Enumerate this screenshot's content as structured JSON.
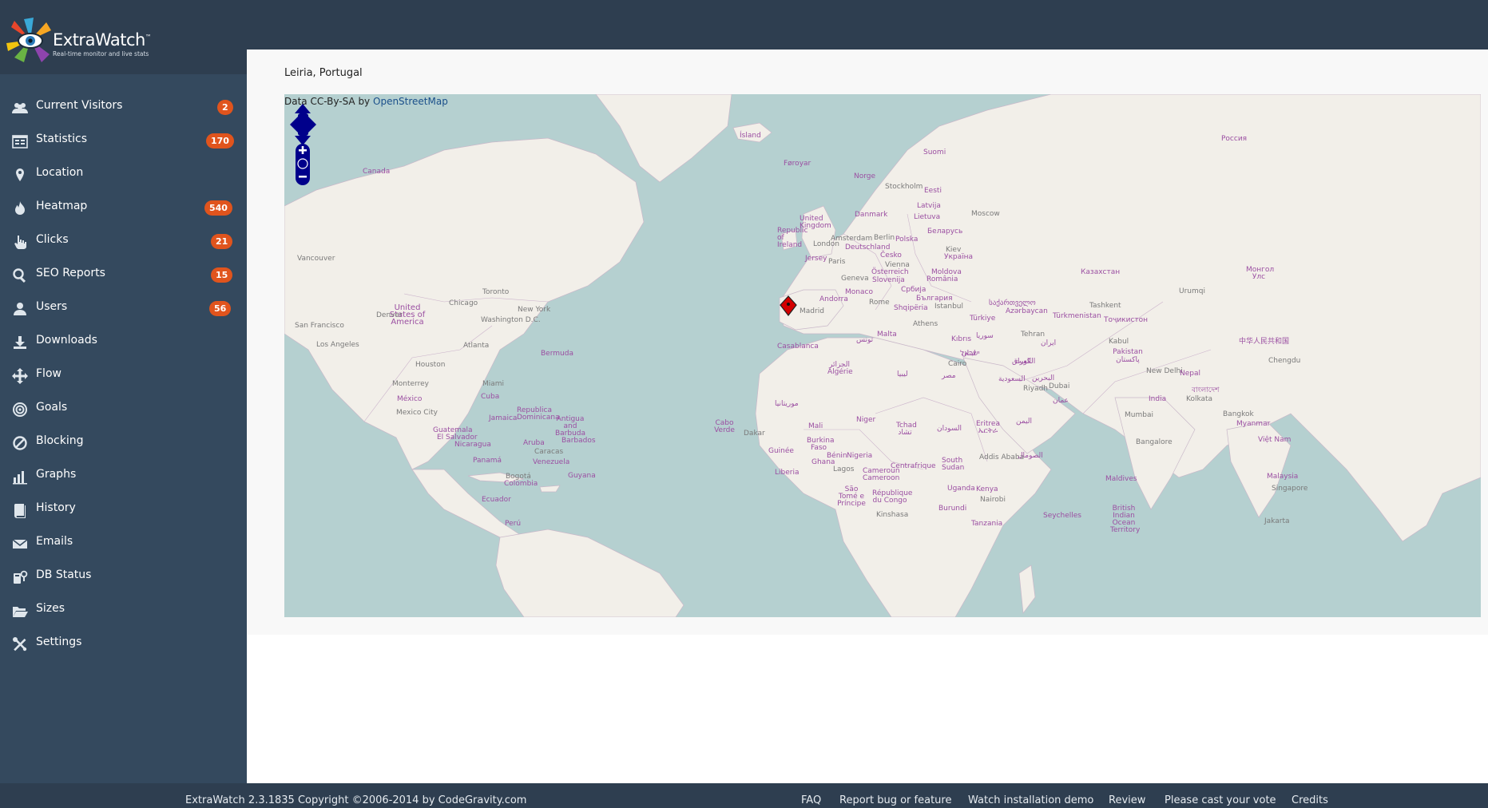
{
  "brand": {
    "name": "ExtraWatch",
    "tm": "™",
    "tagline": "Real-time monitor and live stats"
  },
  "sidebar": {
    "items": [
      {
        "label": "Current Visitors",
        "icon": "users-icon",
        "badge": "2"
      },
      {
        "label": "Statistics",
        "icon": "statistics-icon",
        "badge": "170"
      },
      {
        "label": "Location",
        "icon": "map-pin-icon",
        "badge": null
      },
      {
        "label": "Heatmap",
        "icon": "fire-icon",
        "badge": "540"
      },
      {
        "label": "Clicks",
        "icon": "pointer-hand-icon",
        "badge": "21"
      },
      {
        "label": "SEO Reports",
        "icon": "search-icon",
        "badge": "15"
      },
      {
        "label": "Users",
        "icon": "user-icon",
        "badge": "56"
      },
      {
        "label": "Downloads",
        "icon": "download-icon",
        "badge": null
      },
      {
        "label": "Flow",
        "icon": "flow-arrows-icon",
        "badge": null
      },
      {
        "label": "Goals",
        "icon": "target-icon",
        "badge": null
      },
      {
        "label": "Blocking",
        "icon": "block-icon",
        "badge": null
      },
      {
        "label": "Graphs",
        "icon": "bar-chart-icon",
        "badge": null
      },
      {
        "label": "History",
        "icon": "book-icon",
        "badge": null
      },
      {
        "label": "Emails",
        "icon": "envelope-icon",
        "badge": null
      },
      {
        "label": "DB Status",
        "icon": "database-icon",
        "badge": null
      },
      {
        "label": "Sizes",
        "icon": "folder-open-icon",
        "badge": null
      },
      {
        "label": "Settings",
        "icon": "wrench-icon",
        "badge": null
      }
    ]
  },
  "main": {
    "location": "Leiria, Portugal",
    "map": {
      "attribution_prefix": "Data CC-By-SA by",
      "attribution_link": "OpenStreetMap",
      "marker_location": "Leiria, Portugal",
      "marker_color": "#d40000",
      "water_color": "#b5d0d0",
      "land_color": "#f2efe9",
      "labels": {
        "island": "Ísland",
        "faroyar": "Føroyar",
        "canada": "Canada",
        "suomi": "Suomi",
        "norge": "Norge",
        "rossiya": "Россия",
        "eesti": "Eesti",
        "stockholm": "Stockholm",
        "latvija": "Latvija",
        "lietuva": "Lietuva",
        "danmark": "Danmark",
        "uk": "United Kingdom",
        "ireland": "Republic of Ireland",
        "moscow": "Moscow",
        "belarus": "Беларусь",
        "berlin": "Berlin",
        "amsterdam": "Amsterdam",
        "london": "London",
        "deutschland": "Deutschland",
        "polska": "Polska",
        "kiev": "Kiev",
        "ukraina": "Україна",
        "jersey": "Jersey",
        "paris": "Paris",
        "cesko": "Česko",
        "vienna": "Vienna",
        "geneva": "Geneva",
        "osterreich": "Österreich",
        "slovenija": "Slovenija",
        "moldova": "Moldova",
        "romania": "România",
        "kazakhstan": "Казахстан",
        "mongolia": "Монгол Улс",
        "vancouver": "Vancouver",
        "toronto": "Toronto",
        "chicago": "Chicago",
        "new_york": "New York",
        "washington": "Washington D.C.",
        "usa": "United States of America",
        "denver": "Denver",
        "san_francisco": "San Francisco",
        "los_angeles": "Los Angeles",
        "atlanta": "Atlanta",
        "houston": "Houston",
        "bermuda": "Bermuda",
        "monaco": "Monaco",
        "andorra": "Andorra",
        "madrid": "Madrid",
        "rome": "Rome",
        "srbija": "Србија",
        "bulgaria": "България",
        "shqiperia": "Shqipëria",
        "istanbul": "Istanbul",
        "turkiye": "Türkiye",
        "athens": "Athens",
        "georgia": "საქართველო",
        "azerbaycan": "Azərbaycan",
        "turkmenistan": "Türkmenistan",
        "tajikistan": "Тоҷикистон",
        "tashkent": "Tashkent",
        "urumqi": "Urumqi",
        "china": "中华人民共和国",
        "malta": "Malta",
        "casablanca": "Casablanca",
        "tunisia": "تونس",
        "kibris": "Kıbrıs",
        "syria": "سوريا",
        "lebanon": "لبنان",
        "iraq": "العراق",
        "tehran": "Tehran",
        "iran": "ایران",
        "kabul": "Kabul",
        "pakistan": "Pakistan پاکستان",
        "chengdu": "Chengdu",
        "new_delhi": "New Delhi",
        "nepal": "Nepal",
        "mexico": "México",
        "mexico_city": "Mexico City",
        "monterrey": "Monterrey",
        "miami": "Miami",
        "cuba": "Cuba",
        "algeria": "الجزائر Algérie",
        "libya": "ليبيا",
        "egypt": "مصر",
        "cairo": "Cairo",
        "israel": "ישראל",
        "saudi": "السعودية",
        "riyadh": "Riyadh",
        "kuwait": "الكويت",
        "bahrain": "البحرين",
        "dubai": "Dubai",
        "oman": "عمان",
        "india": "India",
        "kolkata": "Kolkata",
        "bangladesh": "বাংলাদেশ",
        "myanmar": "Myanmar",
        "mauritania": "موريتانيا",
        "dominicana": "Republica Dominicana",
        "jamaica": "Jamaica",
        "antigua": "Antigua and Barbuda",
        "guatemala": "Guatemala",
        "el_salvador": "El Salvador",
        "nicaragua": "Nicaragua",
        "barbados": "Barbados",
        "cabo_verde": "Cabo Verde",
        "dakar": "Dakar",
        "mali": "Mali",
        "niger": "Niger",
        "tchad": "Tchad تشاد",
        "sudan": "السودان",
        "eritrea": "Eritrea ኤርትራ",
        "yemen": "اليمن",
        "mumbai": "Mumbai",
        "bangkok": "Bangkok",
        "viet_nam": "Việt Nam",
        "panama": "Panamá",
        "aruba": "Aruba",
        "caracas": "Caracas",
        "venezuela": "Venezuela",
        "guyana": "Guyana",
        "bogota": "Bogotá",
        "colombia": "Colombia",
        "guinee": "Guinée",
        "burkina": "Burkina Faso",
        "benin": "Bénin",
        "nigeria": "Nigeria",
        "ghana": "Ghana",
        "lagos": "Lagos",
        "centrafrique": "Centrafrique",
        "south_sudan": "South Sudan",
        "addis": "Addis Ababa",
        "somalia": "الصومال",
        "liberia": "Liberia",
        "cameroun": "Cameroun Cameroon",
        "sao_tome": "São Tomé e Príncipe",
        "rdc": "République du Congo",
        "kinshasa": "Kinshasa",
        "uganda": "Uganda",
        "kenya": "Kenya",
        "nairobi": "Nairobi",
        "burundi": "Burundi",
        "tanzania": "Tanzania",
        "ecuador": "Ecuador",
        "peru": "Perú",
        "maldives": "Maldives",
        "bangalore": "Bangalore",
        "malaysia": "Malaysia",
        "singapore": "Singapore",
        "seychelles": "Seychelles",
        "biot": "British Indian Ocean Territory",
        "jakarta": "Jakarta"
      }
    }
  },
  "footer": {
    "copyright": "ExtraWatch 2.3.1835 Copyright ©2006-2014 by CodeGravity.com",
    "links": [
      "FAQ",
      "Report bug or feature",
      "Watch installation demo",
      "Review",
      "Please cast your vote",
      "Credits"
    ]
  }
}
